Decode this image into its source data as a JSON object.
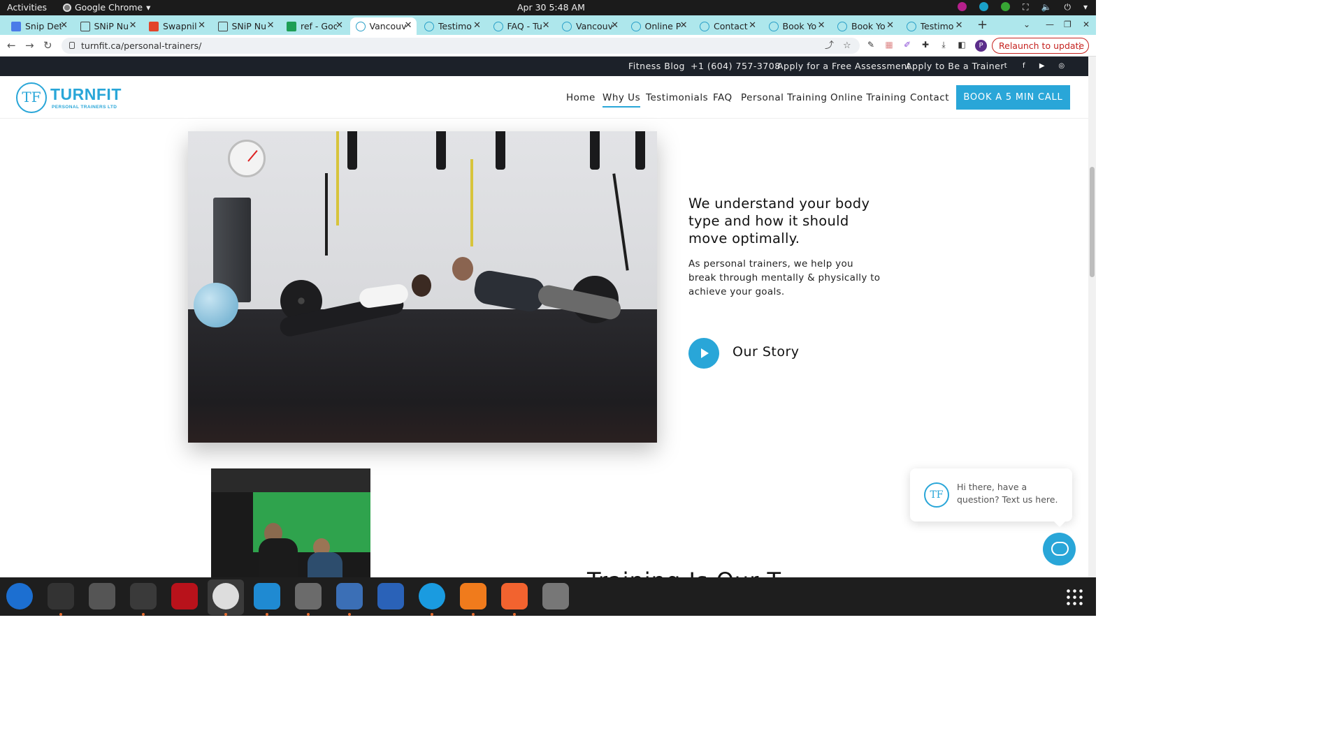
{
  "system": {
    "activities": "Activities",
    "app_name": "Google Chrome",
    "clock": "Apr 30  5:48 AM"
  },
  "tabs": [
    {
      "label": "Snip Det",
      "icon": "doc-icon"
    },
    {
      "label": "SNiP Nu",
      "icon": "snip-icon"
    },
    {
      "label": "Swapnil",
      "icon": "gitlab-icon"
    },
    {
      "label": "SNiP Nu",
      "icon": "snip-icon"
    },
    {
      "label": "ref - Goo",
      "icon": "sheets-icon"
    },
    {
      "label": "Vancouv",
      "icon": "turnfit-icon",
      "active": true
    },
    {
      "label": "Testimo",
      "icon": "turnfit-icon"
    },
    {
      "label": "FAQ - Tu",
      "icon": "turnfit-icon"
    },
    {
      "label": "Vancouv",
      "icon": "turnfit-icon"
    },
    {
      "label": "Online P",
      "icon": "turnfit-icon"
    },
    {
      "label": "Contact",
      "icon": "turnfit-icon"
    },
    {
      "label": "Book Yo",
      "icon": "turnfit-icon"
    },
    {
      "label": "Book Yo",
      "icon": "turnfit-icon"
    },
    {
      "label": "Testimo",
      "icon": "turnfit-icon"
    }
  ],
  "browser": {
    "url": "turnfit.ca/personal-trainers/",
    "relaunch_label": "Relaunch to update",
    "profile_initial": "P"
  },
  "site": {
    "top_links": [
      "Fitness Blog",
      "+1 (604) 757-3708",
      "Apply for a Free Assessment",
      "Apply to Be a Trainer"
    ],
    "logo_mark": "TF",
    "logo_word": "TURNFIT",
    "logo_sub": "PERSONAL TRAINERS LTD",
    "nav": [
      "Home",
      "Why Us",
      "Testimonials",
      "FAQ",
      "Personal Training",
      "Online Training",
      "Contact"
    ],
    "active_nav": "Why Us",
    "cta": "BOOK A 5 MIN CALL",
    "headline": "We understand your body type and how it should move optimally.",
    "subtext": "As personal trainers, we help you break through mentally & physically to achieve your goals.",
    "story_label": "Our Story",
    "partial_heading": "Training Is Our T"
  },
  "chat": {
    "avatar": "TF",
    "message": "Hi there, have a question? Text us here."
  },
  "dock": [
    "thunderbird",
    "terminal",
    "calculator",
    "system-monitor",
    "filezilla",
    "chrome",
    "vscode",
    "files",
    "text-editor",
    "libreoffice-writer",
    "skype",
    "fire-app",
    "pen-app",
    "disk-app"
  ],
  "colors": {
    "accent": "#29a6d8",
    "tabstrip": "#aee7ec",
    "topstrip": "#1c2129"
  }
}
